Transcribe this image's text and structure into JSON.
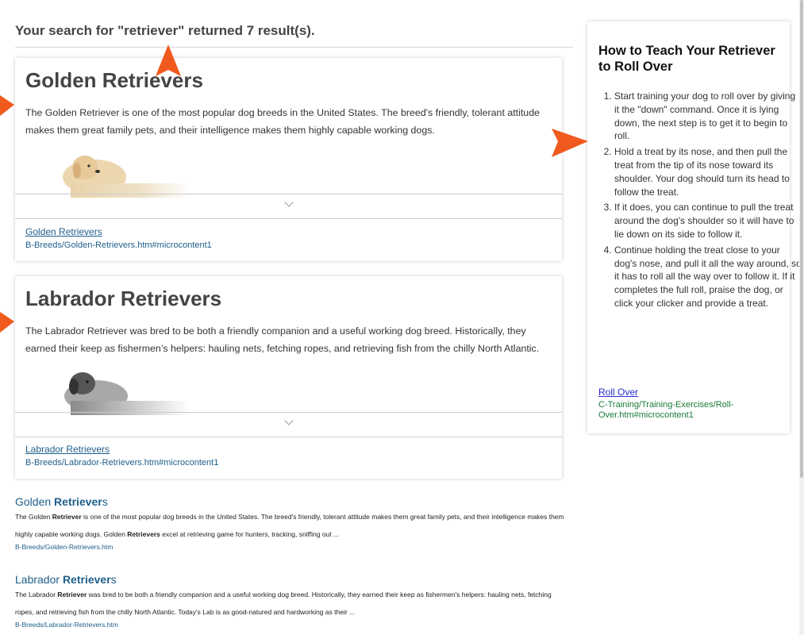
{
  "header": {
    "search_summary": "Your search for \"retriever\" returned 7 result(s)."
  },
  "cards": [
    {
      "title": "Golden Retrievers",
      "body": "The Golden Retriever is one of the most popular dog breeds in the United States. The breed's friendly, tolerant attitude makes them great family pets, and their intelligence makes them highly capable working dogs.",
      "link": "Golden Retrievers",
      "path": "B-Breeds/Golden-Retrievers.htm#microcontent1",
      "image_icon": "golden-retriever-image"
    },
    {
      "title": "Labrador Retrievers",
      "body": "The Labrador Retriever was bred to be both a friendly companion and a useful working dog breed. Historically, they earned their keep as fishermen’s helpers: hauling nets, fetching ropes, and retrieving fish from the chilly North Atlantic.",
      "link": "Labrador Retrievers",
      "path": "B-Breeds/Labrador-Retrievers.htm#microcontent1",
      "image_icon": "labrador-retriever-image"
    }
  ],
  "results": [
    {
      "title_pre": "Golden ",
      "title_bold": "Retriever",
      "title_post": "s",
      "summary_1": "The Golden ",
      "summary_1b": "Retriever",
      "summary_2": " is one of the most popular dog breeds in the United States. The breed's friendly, tolerant attitude makes them great family pets, and their intelligence makes them highly capable working dogs. Golden ",
      "summary_2b": "Retrievers",
      "summary_3": " excel at retrieving game for hunters, tracking, sniffing out ...",
      "path": "B-Breeds/Golden-Retrievers.htm"
    },
    {
      "title_pre": "Labrador ",
      "title_bold": "Retriever",
      "title_post": "s",
      "summary_1": "The Labrador ",
      "summary_1b": "Retriever",
      "summary_2": " was bred to be both a friendly companion and a useful working dog breed. Historically, they earned their keep as fishermen's helpers: hauling nets, fetching ropes, and retrieving fish from the chilly North Atlantic. Today's Lab is as good-natured and hardworking as their ...",
      "summary_2b": "",
      "summary_3": "",
      "path": "B-Breeds/Labrador-Retrievers.htm"
    }
  ],
  "sidebar": {
    "title": "How to Teach Your Retriever to Roll Over",
    "steps": [
      "Start training your dog to roll over by giving it the \"down\" command. Once it is lying down, the next step is to get it to begin to roll.",
      "Hold a treat by its nose, and then pull the treat from the tip of its nose toward its shoulder. Your dog should turn its head to follow the treat.",
      "If it does, you can continue to pull the treat around the dog's shoulder so it will have to lie down on its side to follow it.",
      "Continue holding the treat close to your dog's nose, and pull it all the way around, so it has to roll all the way over to follow it. If it completes the full roll, praise the dog, or click your clicker and provide a treat."
    ],
    "link": "Roll Over",
    "path": "C-Training/Training-Exercises/Roll-Over.htm#microcontent1"
  },
  "colors": {
    "annotation_arrow": "#f05a1e",
    "link_blue": "#1e5f8a",
    "path_green": "#1a7a3a"
  },
  "icons": [
    "chevron-down-icon",
    "annotation-arrow-icon"
  ]
}
